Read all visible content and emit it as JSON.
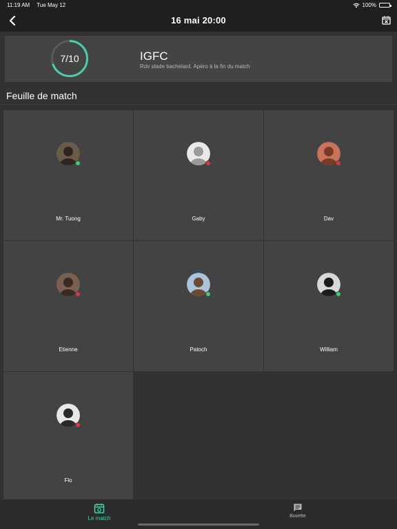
{
  "status_bar": {
    "time": "11:19 AM",
    "date": "Tue May 12",
    "battery": "100%"
  },
  "nav": {
    "title": "16 mai 20:00"
  },
  "header": {
    "progress_label": "7/10",
    "progress_fraction": 0.7,
    "team_name": "IGFC",
    "subtitle": "Rdv stade bachelard. Apéro à la fin du match"
  },
  "section": {
    "title": "Feuille de match"
  },
  "colors": {
    "accent": "#46d1ad",
    "available": "#3ecf6a",
    "unavailable": "#e0353f"
  },
  "players": [
    {
      "name": "Mr. Tuong",
      "status": "available",
      "avatar_bg": "#6a5a48",
      "avatar_fg": "#2d2620"
    },
    {
      "name": "Gaby",
      "status": "unavailable",
      "avatar_bg": "#e9e9e9",
      "avatar_fg": "#9a9a9a"
    },
    {
      "name": "Dav",
      "status": "unavailable",
      "avatar_bg": "#c8735a",
      "avatar_fg": "#7a3a28"
    },
    {
      "name": "Etienne",
      "status": "unavailable",
      "avatar_bg": "#7a6050",
      "avatar_fg": "#3a2a22"
    },
    {
      "name": "Patoch",
      "status": "available",
      "avatar_bg": "#a9c4d8",
      "avatar_fg": "#6a4a34"
    },
    {
      "name": "William",
      "status": "available",
      "avatar_bg": "#d8d8d8",
      "avatar_fg": "#1c1c1c"
    },
    {
      "name": "Flo",
      "status": "unavailable",
      "avatar_bg": "#e8e8e8",
      "avatar_fg": "#2a2a2a"
    }
  ],
  "tabs": [
    {
      "label": "Le match",
      "icon": "calendar-icon",
      "active": true
    },
    {
      "label": "Buvette",
      "icon": "chat-icon",
      "active": false
    }
  ]
}
